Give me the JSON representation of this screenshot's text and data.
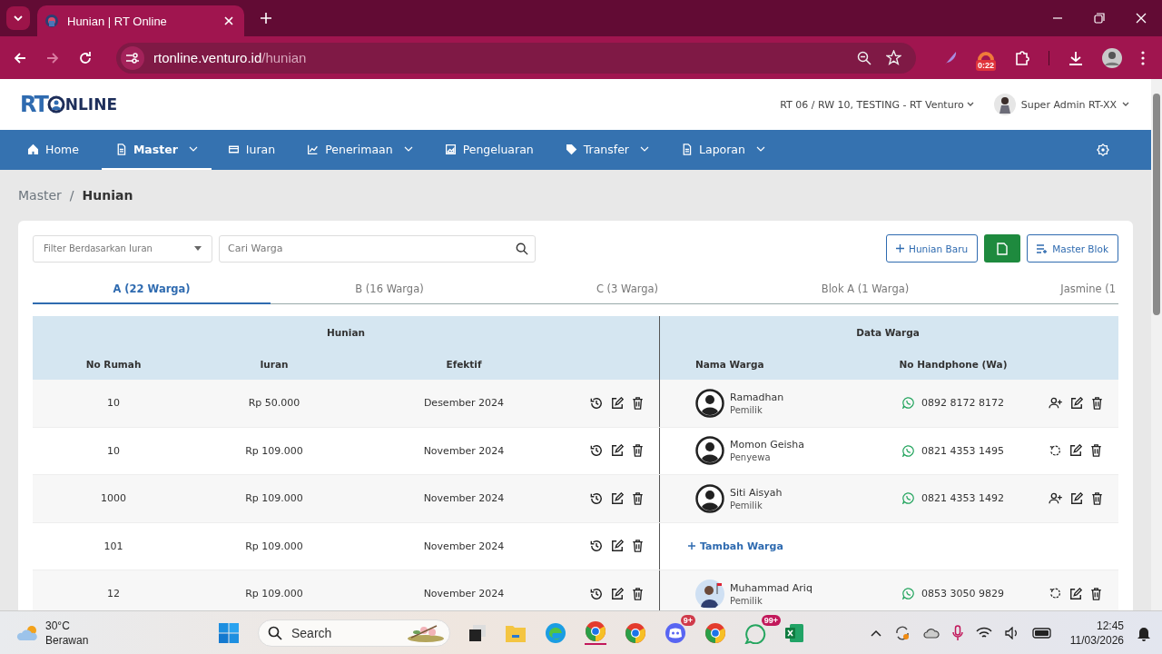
{
  "browser": {
    "tab_title": "Hunian | RT Online",
    "url_host": "rtonline.venturo.id",
    "url_path": "/hunian",
    "extension_badge": "0:22"
  },
  "header": {
    "logo_left": "RT",
    "logo_right": "NLINE",
    "location": "RT 06 / RW 10, TESTING - RT Venturo",
    "user": "Super Admin RT-XX"
  },
  "nav": [
    {
      "label": "Home",
      "dropdown": false,
      "selected": false
    },
    {
      "label": "Master",
      "dropdown": true,
      "selected": true
    },
    {
      "label": "Iuran",
      "dropdown": false,
      "selected": false
    },
    {
      "label": "Penerimaan",
      "dropdown": true,
      "selected": false
    },
    {
      "label": "Pengeluaran",
      "dropdown": false,
      "selected": false
    },
    {
      "label": "Transfer",
      "dropdown": true,
      "selected": false
    },
    {
      "label": "Laporan",
      "dropdown": true,
      "selected": false
    }
  ],
  "breadcrumb": [
    "Master",
    "Hunian"
  ],
  "breadcrumb_separator": "/",
  "toolbar": {
    "filter_placeholder": "Filter Berdasarkan Iuran",
    "search_placeholder": "Cari Warga",
    "new_button": "Hunian Baru",
    "master_button": "Master Blok"
  },
  "blocks": [
    {
      "label": "A (22 Warga)",
      "selected": true
    },
    {
      "label": "B (16 Warga)",
      "selected": false
    },
    {
      "label": "C (3 Warga)",
      "selected": false
    },
    {
      "label": "Blok A (1 Warga)",
      "selected": false
    },
    {
      "label": "Jasmine (1",
      "selected": false
    }
  ],
  "table": {
    "group_hunian": "Hunian",
    "group_warga": "Data Warga",
    "columns": [
      "No Rumah",
      "Iuran",
      "Efektif",
      "Nama Warga",
      "No Handphone (Wa)"
    ],
    "rows": [
      {
        "no_rumah": "10",
        "iuran": "Rp 50.000",
        "efektif": "Desember 2024",
        "warga": {
          "name": "Ramadhan",
          "role": "Pemilik",
          "kind": "icon",
          "phone": "0892 8172 8172",
          "has_account": false
        }
      },
      {
        "no_rumah": "10",
        "iuran": "Rp 109.000",
        "efektif": "November 2024",
        "warga": {
          "name": "Momon Geisha",
          "role": "Penyewa",
          "kind": "icon",
          "phone": "0821 4353 1495",
          "has_account": true
        }
      },
      {
        "no_rumah": "1000",
        "iuran": "Rp 109.000",
        "efektif": "November 2024",
        "warga": {
          "name": "Siti Aisyah",
          "role": "Pemilik",
          "kind": "icon",
          "phone": "0821 4353 1492",
          "has_account": false
        }
      },
      {
        "no_rumah": "101",
        "iuran": "Rp 109.000",
        "efektif": "November 2024",
        "add_warga": "Tambah Warga"
      },
      {
        "no_rumah": "12",
        "iuran": "Rp 109.000",
        "efektif": "November 2024",
        "warga": {
          "name": "Muhammad Ariq",
          "role": "Pemilik",
          "kind": "photo",
          "phone": "0853 3050 9829",
          "has_account": true
        }
      }
    ]
  },
  "taskbar": {
    "temperature": "30°C",
    "weather": "Berawan",
    "search_placeholder": "Search",
    "discord_badge": "9+",
    "whatsapp_badge": "99+",
    "time": "12:45",
    "date": "11/03/2026"
  }
}
